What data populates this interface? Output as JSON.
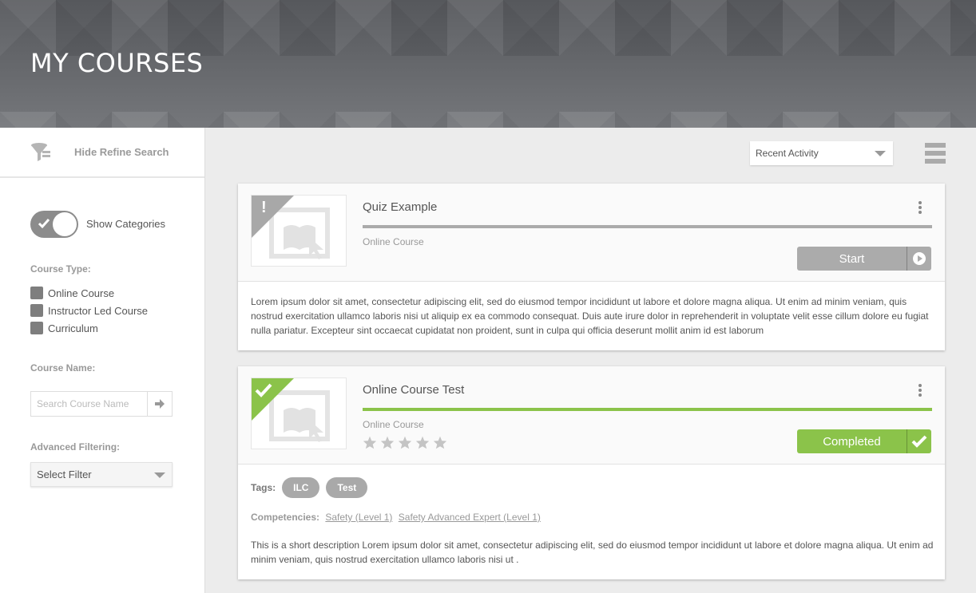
{
  "header": {
    "title": "MY COURSES"
  },
  "sidebar": {
    "refine_label": "Hide Refine Search",
    "toggle_label": "Show Categories",
    "course_type_label": "Course Type:",
    "course_types": [
      "Online Course",
      "Instructor Led Course",
      "Curriculum"
    ],
    "course_name_label": "Course Name:",
    "search_placeholder": "Search Course Name",
    "advanced_label": "Advanced Filtering:",
    "filter_value": "Select Filter"
  },
  "main": {
    "sort_value": "Recent Activity",
    "courses": [
      {
        "title": "Quiz Example",
        "type": "Online Course",
        "action": "Start",
        "status_glyph": "!",
        "description": "Lorem ipsum dolor sit amet, consectetur adipiscing elit, sed do eiusmod tempor incididunt ut labore et dolore magna aliqua. Ut enim ad minim veniam, quis nostrud exercitation ullamco laboris nisi ut aliquip ex ea commodo consequat. Duis aute irure dolor in reprehenderit in voluptate velit esse cillum dolore eu fugiat nulla pariatur. Excepteur sint occaecat cupidatat non proident, sunt in culpa qui officia deserunt mollit anim id est laborum"
      },
      {
        "title": "Online Course Test",
        "type": "Online Course",
        "action": "Completed",
        "tags_label": "Tags:",
        "tags": [
          "ILC",
          "Test"
        ],
        "competencies_label": "Competencies:",
        "competencies": [
          "Safety (Level 1)",
          "Safety Advanced Expert (Level 1)"
        ],
        "description": "This is a short description Lorem ipsum dolor sit amet, consectetur adipiscing elit, sed do eiusmod tempor incididunt ut labore et dolore magna aliqua. Ut enim ad minim veniam, quis nostrud exercitation ullamco laboris nisi ut ."
      }
    ]
  },
  "colors": {
    "accent_green": "#8bc34a",
    "neutral_gray": "#ababab",
    "banner": "#6b6d71"
  }
}
